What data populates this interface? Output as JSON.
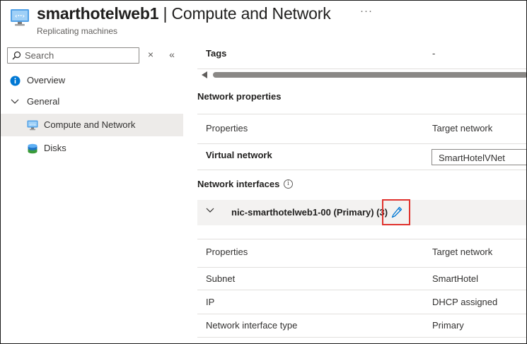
{
  "header": {
    "resource_name": "smarthotelweb1",
    "separator": " | ",
    "page_title": "Compute and Network",
    "subtitle": "Replicating machines",
    "more_label": "···",
    "icon": "vm-network-icon"
  },
  "sidebar": {
    "search_placeholder": "Search",
    "clear_label": "×",
    "collapse_label": "«",
    "items": [
      {
        "label": "Overview",
        "icon": "info-circle-icon"
      },
      {
        "label": "General",
        "icon": "chevron-down-icon"
      },
      {
        "label": "Compute and Network",
        "icon": "vm-network-icon",
        "active": true
      },
      {
        "label": "Disks",
        "icon": "disk-icon"
      }
    ]
  },
  "main": {
    "tags_label": "Tags",
    "tags_value": "-",
    "network_properties": {
      "title": "Network properties",
      "col_properties": "Properties",
      "col_target": "Target network",
      "virtual_network_label": "Virtual network",
      "virtual_network_value": "SmartHotelVNet"
    },
    "network_interfaces": {
      "title": "Network interfaces",
      "info_label": "i",
      "nic_label": "nic-smarthotelweb1-00 (Primary) (3)",
      "col_properties": "Properties",
      "col_target": "Target network",
      "rows": [
        {
          "label": "Subnet",
          "value": "SmartHotel"
        },
        {
          "label": "IP",
          "value": "DHCP assigned"
        },
        {
          "label": "Network interface type",
          "value": "Primary"
        }
      ]
    }
  },
  "colors": {
    "accent": "#0078d4",
    "highlight_border": "#e0322d",
    "active_bg": "#edebe9"
  }
}
